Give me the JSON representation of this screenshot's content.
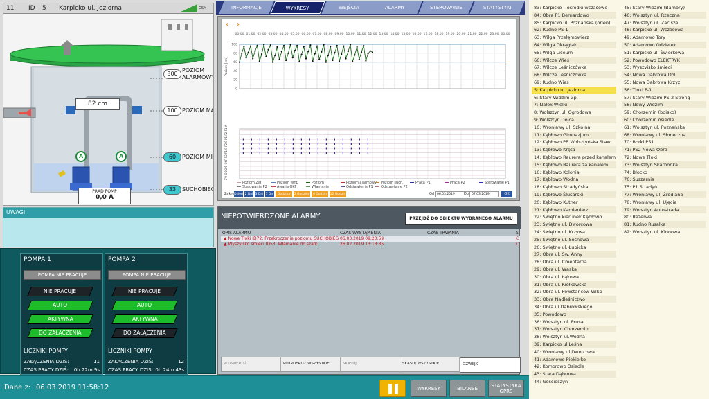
{
  "scada": {
    "id_num": "11",
    "id_label": "ID",
    "id_value": "5",
    "title": "Karpicko ul. Jeziorna",
    "signal_label": "GSM",
    "level_readout": "82 cm",
    "levels": [
      {
        "value": "300",
        "label1": "POZIOM",
        "label2": "ALARMOWY"
      },
      {
        "value": "100",
        "label1": "POZIOM MAX",
        "label2": ""
      },
      {
        "value": "60",
        "label1": "POZIOM MIN",
        "label2": ""
      },
      {
        "value": "33",
        "label1": "SUCHOBIEG",
        "label2": ""
      }
    ],
    "pump_a_label": "A",
    "pump_current_label": "PRĄD POMP",
    "pump_current_value": "0,0 A"
  },
  "uwagi": {
    "title": "UWAGI"
  },
  "pumps": [
    {
      "title": "POMPA 1",
      "status": "POMPA NIE PRACUJE",
      "buttons": [
        "NIE PRACUJE",
        "AUTO",
        "AKTYWNA",
        "DO ZAŁĄCZENIA"
      ],
      "counters_title": "LICZNIKI POMPY",
      "starts_label": "ZAŁĄCZENIA DZIŚ:",
      "starts_value": "11",
      "runtime_label": "CZAS PRACY DZIŚ:",
      "runtime_value": "0h 22m 9s"
    },
    {
      "title": "POMPA 2",
      "status": "POMPA NIE PRACUJE",
      "buttons": [
        "NIE PRACUJE",
        "AUTO",
        "AKTYWNA",
        "DO ZAŁĄCZENIA"
      ],
      "counters_title": "LICZNIKI POMPY",
      "starts_label": "ZAŁĄCZENIA DZIŚ:",
      "starts_value": "12",
      "runtime_label": "CZAS PRACY DZIŚ:",
      "runtime_value": "0h 24m 43s"
    }
  ],
  "bottom": {
    "date_label": "Dane z:",
    "date_value": "06.03.2019 11:58:12",
    "buttons": [
      "WYKRESY",
      "BILANSE",
      "STATYSTYKA GPRS"
    ]
  },
  "tabs": [
    "INFORMACJE",
    "WYKRESY",
    "WEJŚCIA",
    "ALARMY",
    "STEROWANIE",
    "STATYSTYKI"
  ],
  "chart": {
    "legend": [
      "Poziom Zał.",
      "Poziom WYŁ",
      "Poziom",
      "Poziom alarmowy",
      "Poziom such.",
      "Praca P1",
      "Praca P2",
      "Sterowanie P1",
      "Sterowanie P2",
      "Awaria OKF",
      "Włamanie",
      "Odstawienie P1",
      "Odstawienie P2"
    ],
    "zoom_label": "Zakres",
    "zoom_buttons": [
      "Dzień",
      "2 Dni",
      "3 Dni",
      "7 Dni",
      "Godzina",
      "2 Godziny",
      "6 Godzin",
      "12 Godzin"
    ],
    "from_label": "Od",
    "from_value": "06.03.2019",
    "to_label": "Do",
    "to_value": "07.03.2019",
    "ok_label": "OK",
    "ylabel_top": "Poziom [cm]",
    "ylabel_bottom": "ODSP2 ODSP1 OKF P2 P1 S P2 S P1 P2 P1 A"
  },
  "chart_data": {
    "type": "line",
    "x_ticks": [
      "00:00",
      "01:00",
      "02:00",
      "03:00",
      "04:00",
      "05:00",
      "06:00",
      "07:00",
      "08:00",
      "09:00",
      "10:00",
      "11:00",
      "12:00",
      "13:00",
      "14:00",
      "15:00",
      "16:00",
      "17:00",
      "18:00",
      "19:00",
      "20:00",
      "21:00",
      "22:00",
      "23:00",
      "00:00"
    ],
    "y_ticks": [
      0,
      20,
      40,
      60,
      80,
      100
    ],
    "ylim": [
      0,
      100
    ],
    "ylabel": "Poziom [cm]",
    "reference_lines": [
      {
        "name": "Poziom MAX",
        "value": 100
      },
      {
        "name": "Poziom MIN",
        "value": 60
      }
    ],
    "series": [
      {
        "name": "Poziom",
        "x_hours": [
          0.0,
          0.2,
          0.4,
          0.6,
          0.8,
          1.0,
          1.2,
          1.4,
          1.6,
          1.8,
          2.0,
          2.2,
          2.4,
          2.6,
          2.8,
          3.0,
          3.2,
          3.4,
          3.6,
          3.8,
          4.0,
          4.2,
          4.4,
          4.6,
          4.8,
          5.0,
          5.2,
          5.4,
          5.6,
          5.8,
          6.0,
          6.2,
          6.4,
          6.6,
          6.8,
          7.0,
          7.2,
          7.4,
          7.6,
          7.8,
          8.0,
          8.2,
          8.4,
          8.6,
          8.8,
          9.0,
          9.2,
          9.4,
          9.6,
          9.8,
          10.0,
          10.2,
          10.4,
          10.6,
          10.8,
          11.0,
          11.2,
          11.4,
          11.6,
          11.8,
          12.0
        ],
        "values": [
          60,
          80,
          95,
          70,
          82,
          96,
          68,
          85,
          97,
          62,
          78,
          99,
          72,
          88,
          98,
          60,
          75,
          94,
          66,
          84,
          97,
          64,
          80,
          99,
          70,
          86,
          97,
          61,
          77,
          95,
          68,
          84,
          98,
          62,
          79,
          96,
          66,
          83,
          99,
          60,
          75,
          95,
          64,
          81,
          97,
          62,
          78,
          96,
          68,
          84,
          99,
          61,
          76,
          94,
          66,
          82,
          97,
          63,
          79,
          85,
          82
        ]
      }
    ]
  },
  "alarms": {
    "title": "NIEPOTWIERDZONE ALARMY",
    "goto_label": "PRZEJDŹ DO OBIEKTU WYBRANEGO ALARMU",
    "columns": [
      "OPIS ALARMU",
      "CZAS WYSTĄPIENIA",
      "CZAS TRWANIA",
      "S"
    ],
    "rows": [
      {
        "desc": "▲ Nowe  Tłoki ID72: Przekroczenie poziomu SUCHOBIEG",
        "time": "06.03.2019 09:20:59",
        "flag": "C"
      },
      {
        "desc": "▲ Wyszyisko śmieci ID53: Włamanie do szafki",
        "time": "26.02.2019 13:13:35",
        "flag": "C"
      }
    ],
    "footer": [
      "POTWIERDŹ",
      "POTWIERDŹ WSZYSTKIE",
      "SKASUJ",
      "SKASUJ WSZYSTKIE",
      "DŹWIĘK"
    ]
  },
  "objects": {
    "col1": [
      "83: Karpicko – ośrodki wczasowe",
      "84: Obra P1 Bernardowo",
      "85: Karpicko ul. Poznańska (orlen)",
      "62: Rudno PS-1",
      "63: Wilga Przełęmowierz",
      "64: Wilga Okrągłak",
      "65: Wilga Liceum",
      "66: Wilcze Wieś",
      "67: Wilcze Leśniczówka",
      "68: Wilcze Leśniczówka",
      "69: Rudno Wieś",
      "5: Karpicko ul. Jeziorna",
      "6: Stary Widzim 3p.",
      "7: Nałek Wielki",
      "8: Wolsztyn ul. Ogrodowa",
      "9: Wolsztyn Dojca",
      "10: Wroniawy ul. Szkolna",
      "11: Kębłowo Gimnazjum",
      "12: Kębłowo PB Wolsztyńska Staw",
      "13: Kębłowo Kręta",
      "14: Kębłowo Raurera przed kanałem",
      "15: Kębłowo Raurera za kanałem",
      "16: Kębłowo Kolonia",
      "17: Kębłowo Wodna",
      "18: Kębłowo Stradyńska",
      "19: Kębłowo Ślusarski",
      "20: Kębłowo Kutner",
      "21: Kębłowo Kamieniarz",
      "22: Świętno kierunek Kębłowo",
      "23: Świętno ul. Dworcowa",
      "24: Świętno ul. Krzywa",
      "25: Świętno ul. Sosnowa",
      "26: Świętno ul. Łupicka",
      "27: Obra ul. Sw. Anny",
      "28: Obra ul. Cmentarna",
      "29: Obra ul. Wąska",
      "30: Obra ul. Łąkowa",
      "31: Obra ul. Kiełkowska",
      "32: Obra ul. Powstańców Wlkp",
      "33: Obra Nadleśnictwo",
      "34: Obra ul.Dąbrowskiego",
      "35: Powodowo",
      "36: Wolsztyn ul. Prusa",
      "37: Wolsztyn Chorzemin",
      "38: Wolsztyn ul.Wodna",
      "39: Karpicko ul.Leśna",
      "40: Wroniawy ul.Dworcowa",
      "41: Adamowo Piekiełko",
      "42: Komorowo Osiedle",
      "43: Stara Dąbrowa",
      "44: Gościeszyn"
    ],
    "col2": [
      "45: Stary Widzim (Bambry)",
      "46: Wolsztyn ul. Rzeczna",
      "47: Wolsztyn ul. Zacisze",
      "48: Karpicko ul. Wczasowa",
      "49: Adamowo Tory",
      "50: Adamowo Odzierek",
      "51: Karpicko ul. Świerkowa",
      "52: Powodowo ELEKTRYK",
      "53: Wyszyisko śmieci",
      "54: Nowa Dąbrowa Dol",
      "55: Nowa Dąbrowa Krzyż",
      "56: Tłoki P-1",
      "57: Stary Widzim PS-2 Strong",
      "58: Nowy Widzim",
      "59: Chorzemin (boisko)",
      "60: Chorzemin osiedle",
      "61: Wolsztyn ul. Poznańska",
      "68: Wroniawy ul. Słoneczna",
      "70: Borki PS1",
      "71: PS2 Nowa Obra",
      "72: Nowe Tłoki",
      "73: Wolsztyn Skarbonka",
      "74: Błocko",
      "76: Suszarnia",
      "75: P1 Stradyń",
      "77: Wroniawy ul. Źródlana",
      "78: Wroniawy ul. Ujęcie",
      "79: Wolsztyn Autostrada",
      "80: Rezerwa",
      "81: Rudno Rusałka",
      "82: Wolsztyn ul. Klonowa"
    ],
    "selected_index": 11
  },
  "colors": {
    "accent": "#1f8f97",
    "alarm": "#c1121f",
    "tab_active": "#16226a",
    "level_line": "#1a6a1a"
  }
}
